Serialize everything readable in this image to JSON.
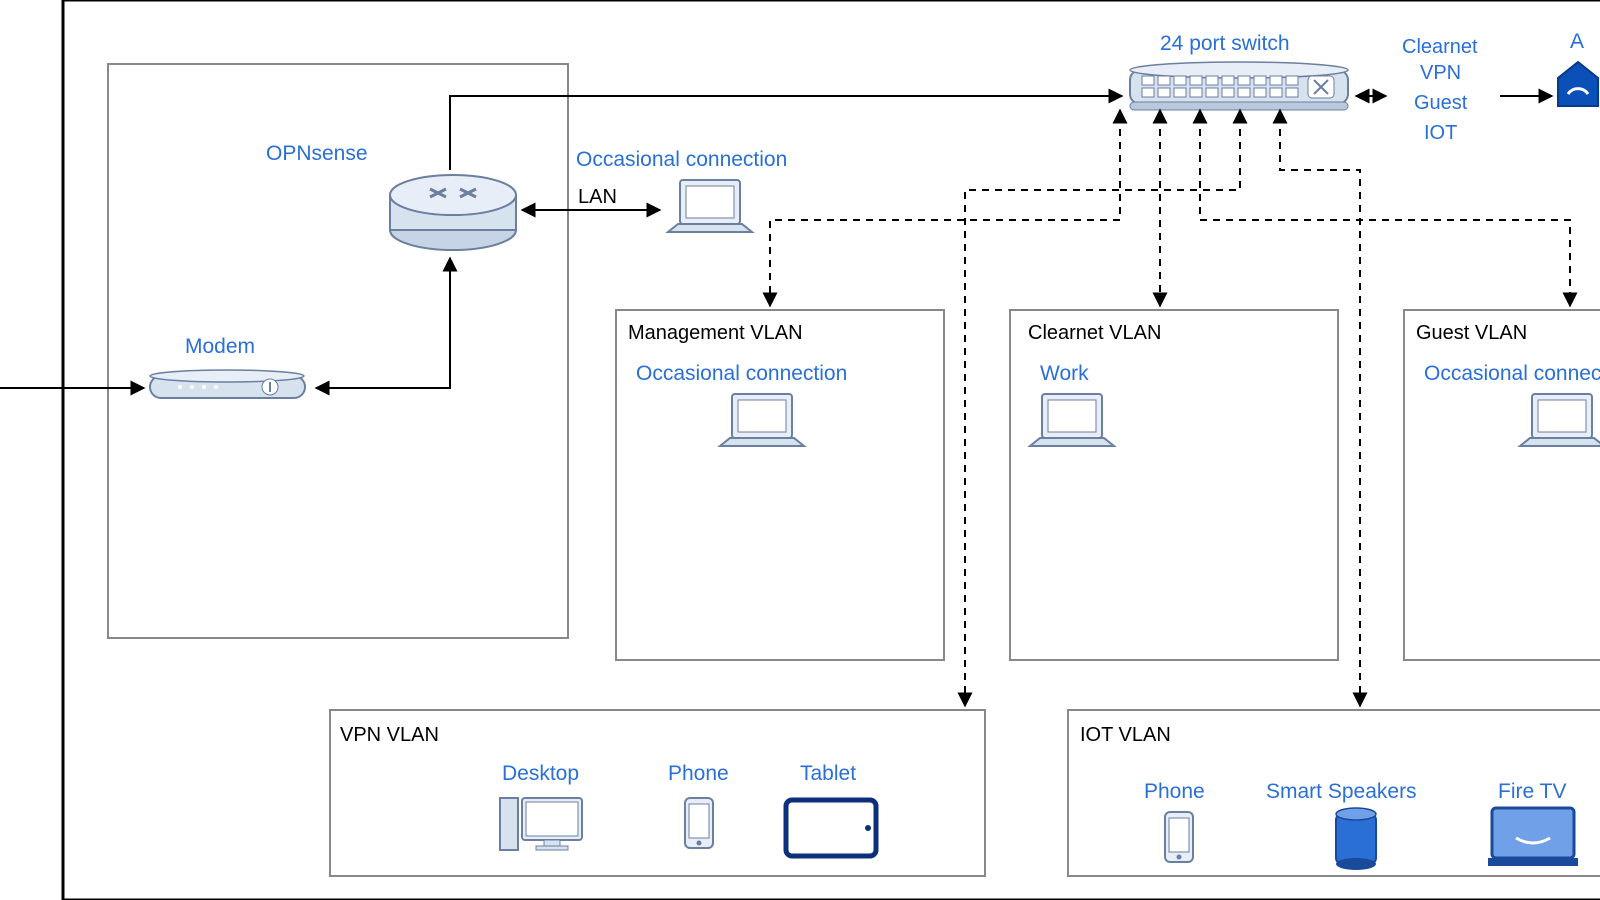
{
  "nodes": {
    "modem": {
      "title": "Modem"
    },
    "opnsense": {
      "title": "OPNsense"
    },
    "switch": {
      "title": "24 port switch"
    },
    "trunk": [
      "Clearnet",
      "VPN",
      "Guest",
      "IOT"
    ],
    "occ_lan": {
      "title": "Occasional connection",
      "link": "LAN"
    },
    "ap": {
      "title": "A"
    },
    "vlans": {
      "mgmt": {
        "title": "Management VLAN"
      },
      "clearnet": {
        "title": "Clearnet VLAN"
      },
      "guest": {
        "title": "Guest VLAN"
      },
      "vpn": {
        "title": "VPN VLAN"
      },
      "iot": {
        "title": "IOT VLAN"
      }
    },
    "devices": {
      "mgmt_laptop": {
        "title": "Occasional connection"
      },
      "clearnet_laptop": {
        "title": "Work"
      },
      "guest_laptop": {
        "title": "Occasional connection"
      },
      "desktop": {
        "title": "Desktop"
      },
      "phone_vpn": {
        "title": "Phone"
      },
      "tablet": {
        "title": "Tablet"
      },
      "phone_iot": {
        "title": "Phone"
      },
      "speaker": {
        "title": "Smart Speakers"
      },
      "firetv": {
        "title": "Fire TV"
      }
    }
  },
  "colors": {
    "accent": "#2a6fd6",
    "device_fill": "#d7e2ef",
    "device_stroke": "#6b7fa0",
    "tablet_stroke": "#0b2f7a",
    "speaker_fill": "#2a6fd6"
  }
}
